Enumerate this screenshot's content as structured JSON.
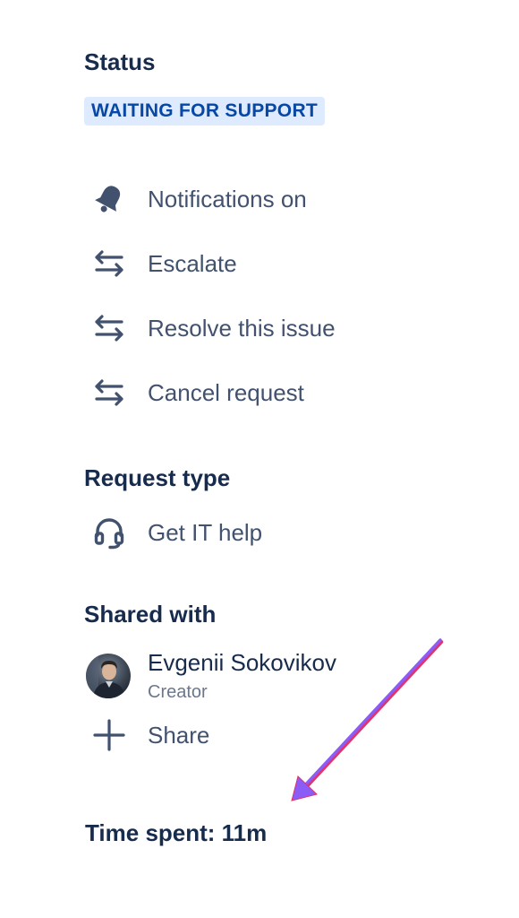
{
  "status": {
    "heading": "Status",
    "value": "WAITING FOR SUPPORT"
  },
  "actions": [
    {
      "label": "Notifications on",
      "icon": "bell-icon"
    },
    {
      "label": "Escalate",
      "icon": "transition-arrows-icon"
    },
    {
      "label": "Resolve this issue",
      "icon": "transition-arrows-icon"
    },
    {
      "label": "Cancel request",
      "icon": "transition-arrows-icon"
    }
  ],
  "request_type": {
    "heading": "Request type",
    "value": "Get IT help",
    "icon": "headset-icon"
  },
  "shared_with": {
    "heading": "Shared with",
    "person": {
      "name": "Evgenii Sokovikov",
      "role": "Creator"
    },
    "share_label": "Share",
    "share_icon": "plus-icon"
  },
  "time_spent": "Time spent: 11m",
  "colors": {
    "heading": "#172b4d",
    "label": "#42526e",
    "lozenge_bg": "#deebff",
    "lozenge_text": "#0747a6",
    "annotation_arrow": "#8b5cf6"
  }
}
